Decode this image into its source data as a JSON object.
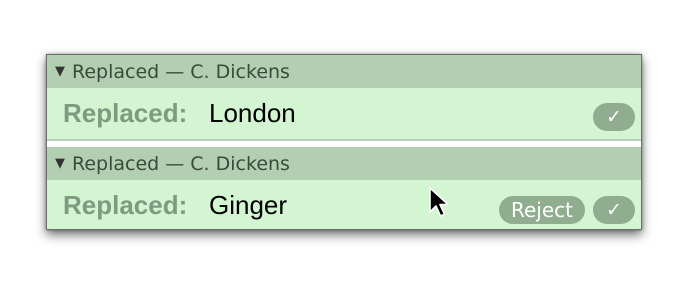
{
  "changes": [
    {
      "header": "Replaced — C. Dickens",
      "label": "Replaced:",
      "value": "London",
      "accept_icon": "✓"
    },
    {
      "header": "Replaced — C. Dickens",
      "label": "Replaced:",
      "value": "Ginger",
      "reject_label": "Reject",
      "accept_icon": "✓"
    }
  ],
  "icons": {
    "disclosure": "disclosure-triangle-icon",
    "accept": "checkmark-icon",
    "pointer": "mouse-pointer-icon"
  },
  "colors": {
    "header_bg": "#b3cfb1",
    "body_bg": "#d3f5d2",
    "button_bg": "#91ad90",
    "label_color": "#809a80"
  }
}
